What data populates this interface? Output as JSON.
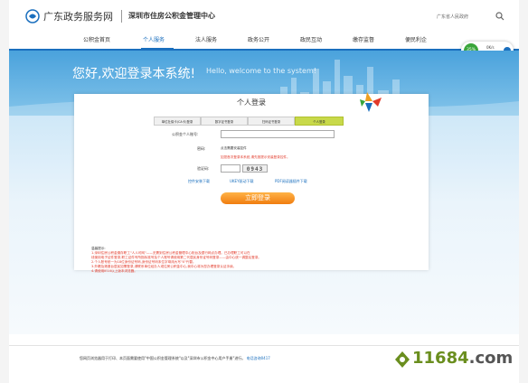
{
  "header": {
    "site_name": "广东政务服务网",
    "subtitle": "深圳市住房公积金管理中心",
    "gov_link": "广东省人民政府",
    "search_icon": "search-icon",
    "logo_icon": "guangdong-gov-logo"
  },
  "nav": {
    "items": [
      "公积金首页",
      "个人服务",
      "法人服务",
      "政务公开",
      "政民互动",
      "缴存监督",
      "便民利企"
    ],
    "active_index": 1
  },
  "status_widget": {
    "percent": "35%",
    "line1": "0K/s",
    "line2": "0K/s"
  },
  "banner": {
    "welcome_cn": "您好,欢迎登录本系统!",
    "welcome_en": "Hello, welcome to the system!"
  },
  "login": {
    "title": "个人登录",
    "tabs": [
      "单位社保卡(CA卡)登录",
      "数字证书登录",
      "扫码证书登录",
      "个人登录"
    ],
    "active_tab": 3,
    "account_label": "公积金个人账号:",
    "cert_label": "密码:",
    "cert_hint": "点击需要安装控件",
    "red_hint": "如您首次登录本系统,请先按提示安装登录控件。",
    "captcha_label": "验证码:",
    "captcha_text": "0943",
    "links": [
      "控件安装下载",
      "UKEY驱动下载",
      "PDF阅读器插件下载"
    ],
    "button": "立即登录",
    "notes_title": "温馨提示:",
    "notes": [
      "1.深圳住房公积金缴存职工\"人人可网\"——无需到住房公积金管理中心柜台及银行网点办理。已办理职工可以在",
      "   线使用电子证件登录,职工证件号所指标准号及个人账号请使用第二代居民身份证号码登录——由中心统一调整后登录。",
      "2.个人账号统一为18位身份证号码,身份证号码末位字母用大写\"X\"代替。",
      "3.外籍及港澳台居民如需登录,请联系单位经办人或住房公积金中心,我中心将为您办理登录认证手续。",
      "4.请使用IE10以上版本浏览器。"
    ]
  },
  "footer": {
    "text": "您网页浏览器用于打印、本页面需要使用\"中国公积金管理系统\"以及\"深圳市公积金中心用户手册\"进行。",
    "link": "电话咨询0417"
  },
  "watermark": {
    "text_green": "11684",
    "text_gray": ".com"
  },
  "colors": {
    "brand_blue": "#1a6fbe",
    "orange_button": "#f07d10",
    "active_tab": "#c8d94a",
    "warning_red": "#e23a2a"
  }
}
